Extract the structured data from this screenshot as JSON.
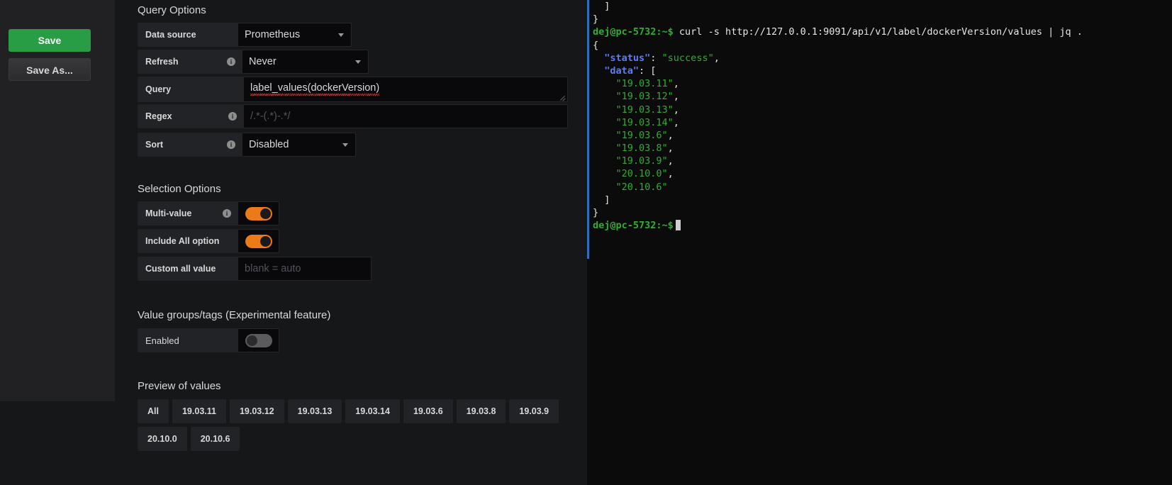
{
  "sidebar": {
    "save_label": "Save",
    "save_as_label": "Save As..."
  },
  "query_options": {
    "title": "Query Options",
    "rows": [
      {
        "label": "Data source",
        "value": "Prometheus",
        "has_info": false,
        "type": "select"
      },
      {
        "label": "Refresh",
        "value": "Never",
        "has_info": true,
        "type": "select"
      },
      {
        "label": "Query",
        "value": "label_values(dockerVersion)",
        "has_info": false,
        "type": "textarea"
      },
      {
        "label": "Regex",
        "value": "",
        "placeholder": "/.*-(.*)-.*/",
        "has_info": true,
        "type": "text"
      },
      {
        "label": "Sort",
        "value": "Disabled",
        "has_info": true,
        "type": "select"
      }
    ]
  },
  "selection_options": {
    "title": "Selection Options",
    "multi_value": {
      "label": "Multi-value",
      "state": "on",
      "has_info": true
    },
    "include_all": {
      "label": "Include All option",
      "state": "on",
      "has_info": false
    },
    "custom_all": {
      "label": "Custom all value",
      "value": "",
      "placeholder": "blank = auto"
    }
  },
  "value_groups": {
    "title": "Value groups/tags (Experimental feature)",
    "enabled": {
      "label": "Enabled",
      "state": "off"
    }
  },
  "preview": {
    "title": "Preview of values",
    "values": [
      "All",
      "19.03.11",
      "19.03.12",
      "19.03.13",
      "19.03.14",
      "19.03.6",
      "19.03.8",
      "19.03.9",
      "20.10.0",
      "20.10.6"
    ]
  },
  "terminal": {
    "lines": [
      [
        {
          "t": "plain",
          "s": "  ]"
        }
      ],
      [
        {
          "t": "plain",
          "s": "}"
        }
      ],
      [
        {
          "t": "prompt",
          "s": "dej@pc-5732:~$"
        },
        {
          "t": "plain",
          "s": " curl -s http://127.0.0.1:9091/api/v1/label/dockerVersion/values | jq ."
        }
      ],
      [
        {
          "t": "plain",
          "s": "{"
        }
      ],
      [
        {
          "t": "key",
          "s": "  \"status\""
        },
        {
          "t": "plain",
          "s": ": "
        },
        {
          "t": "str",
          "s": "\"success\""
        },
        {
          "t": "plain",
          "s": ","
        }
      ],
      [
        {
          "t": "key",
          "s": "  \"data\""
        },
        {
          "t": "plain",
          "s": ": ["
        }
      ],
      [
        {
          "t": "str",
          "s": "    \"19.03.11\""
        },
        {
          "t": "plain",
          "s": ","
        }
      ],
      [
        {
          "t": "str",
          "s": "    \"19.03.12\""
        },
        {
          "t": "plain",
          "s": ","
        }
      ],
      [
        {
          "t": "str",
          "s": "    \"19.03.13\""
        },
        {
          "t": "plain",
          "s": ","
        }
      ],
      [
        {
          "t": "str",
          "s": "    \"19.03.14\""
        },
        {
          "t": "plain",
          "s": ","
        }
      ],
      [
        {
          "t": "str",
          "s": "    \"19.03.6\""
        },
        {
          "t": "plain",
          "s": ","
        }
      ],
      [
        {
          "t": "str",
          "s": "    \"19.03.8\""
        },
        {
          "t": "plain",
          "s": ","
        }
      ],
      [
        {
          "t": "str",
          "s": "    \"19.03.9\""
        },
        {
          "t": "plain",
          "s": ","
        }
      ],
      [
        {
          "t": "str",
          "s": "    \"20.10.0\""
        },
        {
          "t": "plain",
          "s": ","
        }
      ],
      [
        {
          "t": "str",
          "s": "    \"20.10.6\""
        }
      ],
      [
        {
          "t": "plain",
          "s": "  ]"
        }
      ],
      [
        {
          "t": "plain",
          "s": "}"
        }
      ],
      [
        {
          "t": "prompt",
          "s": "dej@pc-5732:~$"
        },
        {
          "t": "cursor",
          "s": ""
        }
      ]
    ]
  },
  "colors": {
    "accent_on": "#eb7b18",
    "save_green": "#299c46",
    "terminal_green": "#2fae2f",
    "terminal_key_blue": "#5c7cfa",
    "scrollbar_blue": "#2f6fb5"
  }
}
